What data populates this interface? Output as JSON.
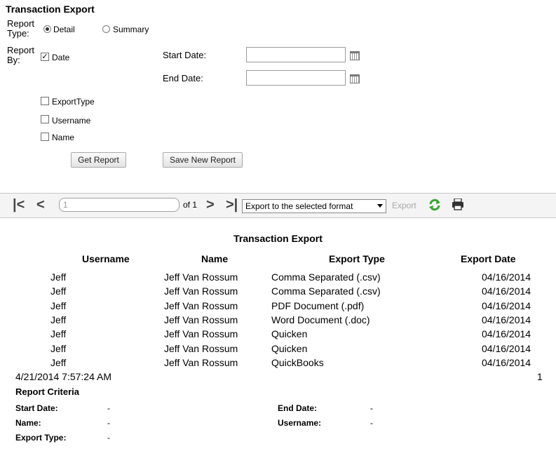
{
  "form": {
    "title": "Transaction Export",
    "report_type_label": "Report Type:",
    "report_type_label_line1": "Report",
    "report_type_label_line2": "Type:",
    "report_type_options": [
      "Detail",
      "Summary"
    ],
    "report_type_selected": "Detail",
    "report_by_line1": "Report",
    "report_by_line2": "By:",
    "date_checkbox_label": "Date",
    "start_date_label": "Start Date:",
    "end_date_label": "End Date:",
    "start_date_value": "",
    "end_date_value": "",
    "exporttype_label": "ExportType",
    "username_label": "Username",
    "name_label": "Name",
    "get_report_label": "Get Report",
    "save_new_report_label": "Save New Report"
  },
  "toolbar": {
    "page_value": "1",
    "of_label": "of 1",
    "format_selected": "Export to the selected format",
    "export_label": "Export"
  },
  "report": {
    "title": "Transaction Export",
    "columns": [
      "Username",
      "Name",
      "Export Type",
      "Export Date"
    ],
    "rows": [
      {
        "username": "Jeff",
        "name": "Jeff Van Rossum",
        "export_type": "Comma Separated (.csv)",
        "export_date": "04/16/2014"
      },
      {
        "username": "Jeff",
        "name": "Jeff Van Rossum",
        "export_type": "Comma Separated (.csv)",
        "export_date": "04/16/2014"
      },
      {
        "username": "Jeff",
        "name": "Jeff Van Rossum",
        "export_type": "PDF Document (.pdf)",
        "export_date": "04/16/2014"
      },
      {
        "username": "Jeff",
        "name": "Jeff Van Rossum",
        "export_type": "Word Document (.doc)",
        "export_date": "04/16/2014"
      },
      {
        "username": "Jeff",
        "name": "Jeff Van Rossum",
        "export_type": "Quicken",
        "export_date": "04/16/2014"
      },
      {
        "username": "Jeff",
        "name": "Jeff Van Rossum",
        "export_type": "Quicken",
        "export_date": "04/16/2014"
      },
      {
        "username": "Jeff",
        "name": "Jeff Van Rossum",
        "export_type": "QuickBooks",
        "export_date": "04/16/2014"
      }
    ],
    "timestamp": "4/21/2014 7:57:24 AM",
    "page_number": "1",
    "criteria_title": "Report Criteria",
    "criteria": {
      "start_date_label": "Start Date:",
      "start_date_value": "-",
      "end_date_label": "End Date:",
      "end_date_value": "-",
      "name_label": "Name:",
      "name_value": "-",
      "username_label": "Username:",
      "username_value": "-",
      "export_type_label": "Export Type:",
      "export_type_value": "-"
    }
  },
  "icons": {
    "first": "first-page-icon",
    "prev": "previous-page-icon",
    "next": "next-page-icon",
    "last": "last-page-icon",
    "refresh": "refresh-icon",
    "print": "print-icon",
    "calendar": "calendar-icon"
  },
  "colors": {
    "refresh_green": "#3aa435",
    "toolbar_bg": "#f4f4f4"
  }
}
